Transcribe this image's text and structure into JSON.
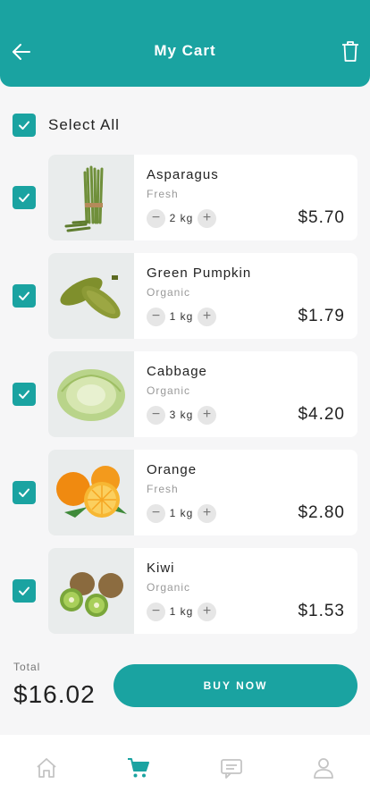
{
  "header": {
    "title": "My Cart",
    "back_icon": "back-arrow-icon",
    "delete_icon": "trash-icon"
  },
  "select_all": {
    "label": "Select All",
    "checked": true
  },
  "items": [
    {
      "name": "Asparagus",
      "type": "Fresh",
      "qty": "2 kg",
      "price": "$5.70",
      "checked": true,
      "image": "asparagus"
    },
    {
      "name": "Green Pumpkin",
      "type": "Organic",
      "qty": "1 kg",
      "price": "$1.79",
      "checked": true,
      "image": "green-pumpkin"
    },
    {
      "name": "Cabbage",
      "type": "Organic",
      "qty": "3 kg",
      "price": "$4.20",
      "checked": true,
      "image": "cabbage"
    },
    {
      "name": "Orange",
      "type": "Fresh",
      "qty": "1 kg",
      "price": "$2.80",
      "checked": true,
      "image": "orange"
    },
    {
      "name": "Kiwi",
      "type": "Organic",
      "qty": "1 kg",
      "price": "$1.53",
      "checked": true,
      "image": "kiwi"
    }
  ],
  "footer": {
    "total_label": "Total",
    "total_value": "$16.02",
    "buy_label": "BUY NOW"
  },
  "tabs": [
    {
      "icon": "home-icon",
      "active": false
    },
    {
      "icon": "cart-icon",
      "active": true
    },
    {
      "icon": "chat-icon",
      "active": false
    },
    {
      "icon": "profile-icon",
      "active": false
    }
  ],
  "colors": {
    "accent": "#1aa3a1",
    "inactive_icon": "#c4c4c4"
  }
}
